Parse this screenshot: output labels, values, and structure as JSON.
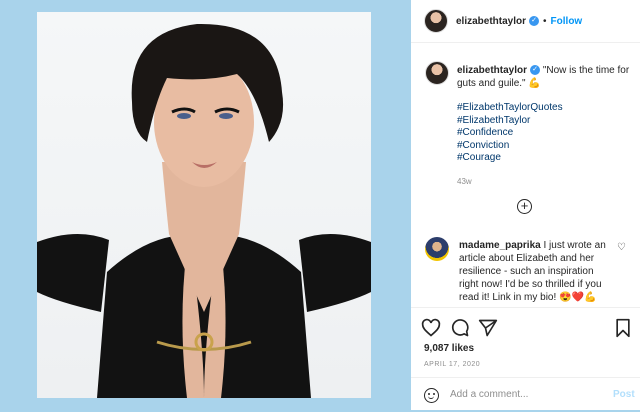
{
  "colors": {
    "background": "#a8d4ec",
    "link": "#00376b",
    "follow": "#0095f6",
    "muted": "#8e8e8e"
  },
  "header": {
    "username": "elizabethtaylor",
    "separator": "•",
    "follow_label": "Follow"
  },
  "caption": {
    "username": "elizabethtaylor",
    "text": "\"Now is the time for guts and guile.\" 💪",
    "hashtags": [
      "#ElizabethTaylorQuotes",
      "#ElizabethTaylor",
      "#Confidence",
      "#Conviction",
      "#Courage"
    ],
    "time": "43w"
  },
  "comment": {
    "username": "madame_paprika",
    "text": "I just wrote an article about Elizabeth and her resilience - such an inspiration right now! I'd be so thrilled if you read it! Link in my bio! 😍❤️💪"
  },
  "stats": {
    "likes": "9,087 likes",
    "date": "APRIL 17, 2020"
  },
  "composer": {
    "placeholder": "Add a comment...",
    "post_label": "Post"
  }
}
